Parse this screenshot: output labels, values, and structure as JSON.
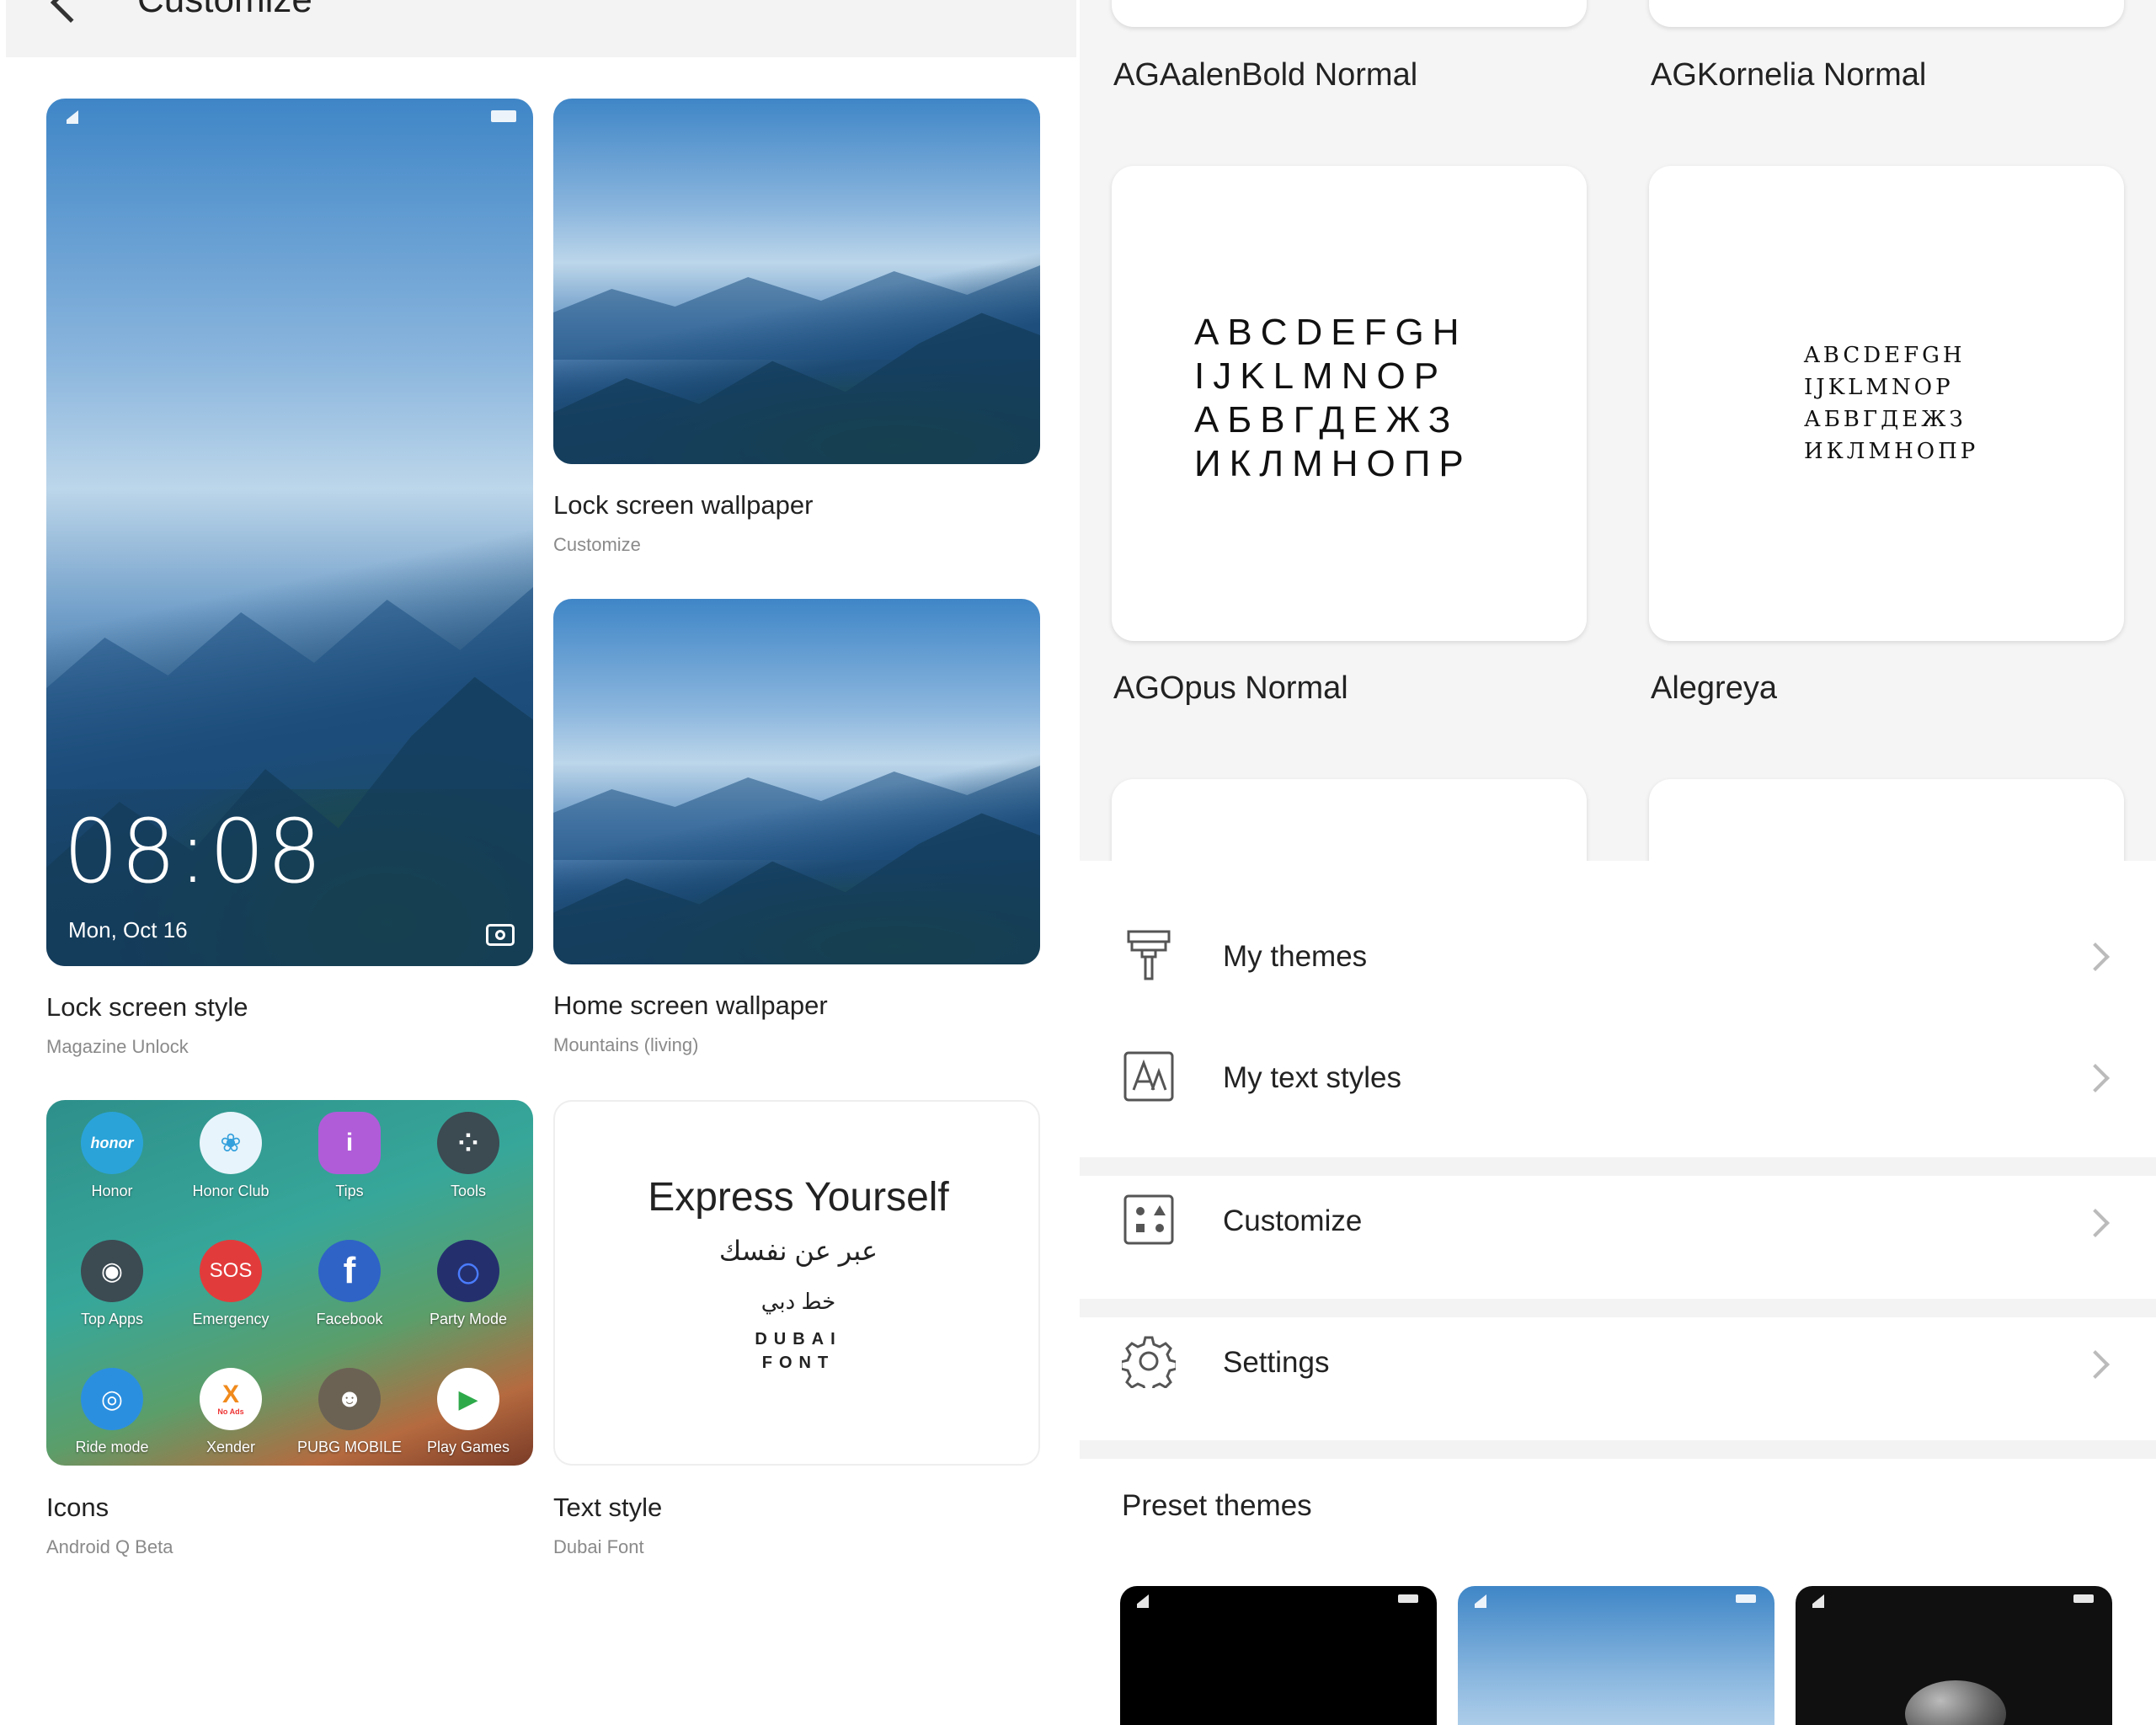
{
  "left_header": {
    "title": "Customize"
  },
  "lock_style": {
    "time": "08:08",
    "date": "Mon, Oct 16",
    "label": "Lock screen style",
    "sub": "Magazine Unlock"
  },
  "lock_wallpaper": {
    "label": "Lock screen wallpaper",
    "sub": "Customize"
  },
  "home_wallpaper": {
    "label": "Home screen wallpaper",
    "sub": "Mountains (living)"
  },
  "icons": {
    "label": "Icons",
    "sub": "Android Q Beta",
    "apps": [
      {
        "name": "Honor",
        "glyph": "honor",
        "color": "#2aa3d9"
      },
      {
        "name": "Honor Club",
        "glyph": "❀",
        "color": "#e8f4fb"
      },
      {
        "name": "Tips",
        "glyph": "i",
        "color": "#b05cd9"
      },
      {
        "name": "Tools",
        "glyph": "⁘",
        "color": "#3c4a52"
      },
      {
        "name": "Top Apps",
        "glyph": "◉",
        "color": "#3c4a52"
      },
      {
        "name": "Emergency",
        "glyph": "SOS",
        "color": "#e23b3b"
      },
      {
        "name": "Facebook",
        "glyph": "f",
        "color": "#2f63c6"
      },
      {
        "name": "Party Mode",
        "glyph": "○",
        "color": "#24306e"
      },
      {
        "name": "Ride mode",
        "glyph": "◎",
        "color": "#2b8fe0"
      },
      {
        "name": "Xender",
        "glyph": "X",
        "color": "#ffffff"
      },
      {
        "name": "PUBG MOBILE",
        "glyph": "☻",
        "color": "#6b6254"
      },
      {
        "name": "Play Games",
        "glyph": "▶",
        "color": "#2ea94a"
      }
    ],
    "xender_badge": "No Ads"
  },
  "text_style": {
    "label": "Text style",
    "sub": "Dubai Font",
    "headline": "Express Yourself",
    "arabic": "عبر عن نفسك",
    "arabic_font": "خط دبي",
    "font_name": "DUBAI\nFONT"
  },
  "fonts": [
    {
      "name": "AGAalenBold Normal"
    },
    {
      "name": "AGKornelia Normal"
    },
    {
      "name": "AGOpus Normal",
      "sample": "ABCDEFGH\nIJKLMNOP\nАБВГДЕЖЗ\nИКЛМНОПР"
    },
    {
      "name": "Alegreya",
      "sample": "ABCDEFGH\nIJKLMNOP\nАБВГДЕЖЗ\nИКЛМНОПР"
    }
  ],
  "menu": [
    {
      "label": "My themes",
      "icon": "paintbrush-icon"
    },
    {
      "label": "My text styles",
      "icon": "text-style-icon"
    },
    {
      "label": "Customize",
      "icon": "customize-grid-icon"
    },
    {
      "label": "Settings",
      "icon": "gear-icon"
    }
  ],
  "preset_themes": {
    "label": "Preset themes"
  },
  "colors": {
    "accent_blue": "#3f86c7",
    "divider": "#e6e6e6",
    "muted": "#8a8a8a"
  }
}
